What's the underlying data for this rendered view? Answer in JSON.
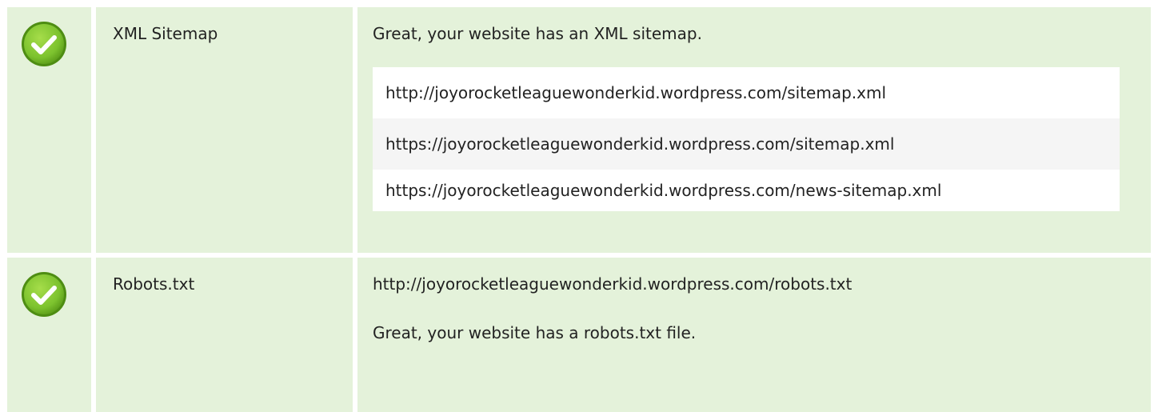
{
  "checks": [
    {
      "label": "XML Sitemap",
      "status": "pass",
      "icon": "check-circle-icon",
      "message": "Great, your website has an XML sitemap.",
      "urls": [
        "http://joyorocketleaguewonderkid.wordpress.com/sitemap.xml",
        "https://joyorocketleaguewonderkid.wordpress.com/sitemap.xml",
        "https://joyorocketleaguewonderkid.wordpress.com/news-sitemap.xml"
      ]
    },
    {
      "label": "Robots.txt",
      "status": "pass",
      "icon": "check-circle-icon",
      "url": "http://joyorocketleaguewonderkid.wordpress.com/robots.txt",
      "message": "Great, your website has a robots.txt file."
    }
  ],
  "colors": {
    "row_background": "#e4f2da",
    "check_green": "#7cc22e",
    "check_dark": "#4e8d13"
  }
}
